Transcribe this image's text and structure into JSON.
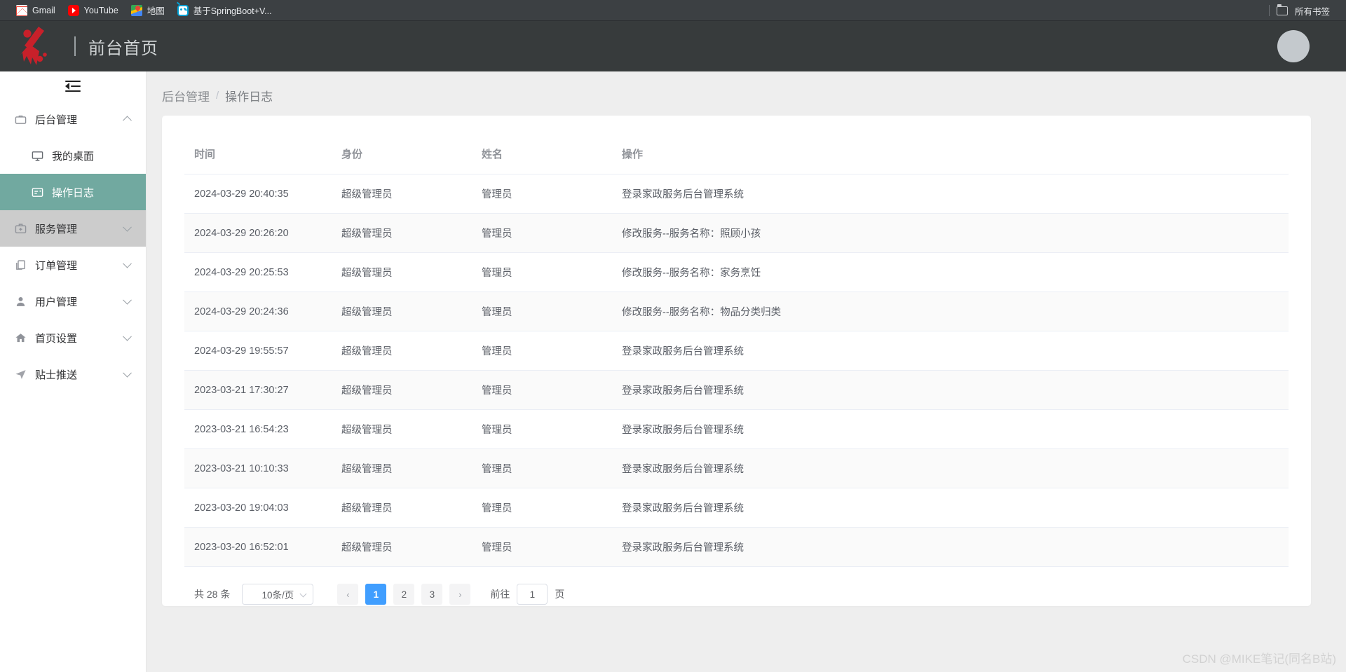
{
  "browser": {
    "bookmarks": [
      {
        "label": "Gmail",
        "icon": "gmail-icon"
      },
      {
        "label": "YouTube",
        "icon": "youtube-icon"
      },
      {
        "label": "地图",
        "icon": "maps-icon"
      },
      {
        "label": "基于SpringBoot+V...",
        "icon": "bilibili-icon"
      }
    ],
    "all_bookmarks_label": "所有书签",
    "all_bookmarks_icon": "folder-icon"
  },
  "header": {
    "logo_icon": "broom-logo-icon",
    "title": "前台首页",
    "avatar_icon": "user-avatar"
  },
  "sidebar": {
    "collapse_icon": "menu-fold-icon",
    "items": [
      {
        "label": "后台管理",
        "icon": "briefcase-icon",
        "expanded": true,
        "state": "normal",
        "children": [
          {
            "label": "我的桌面",
            "icon": "monitor-icon",
            "active": false
          },
          {
            "label": "操作日志",
            "icon": "log-message-icon",
            "active": true
          }
        ]
      },
      {
        "label": "服务管理",
        "icon": "first-aid-kit-icon",
        "expanded": false,
        "state": "hovered",
        "children": []
      },
      {
        "label": "订单管理",
        "icon": "documents-copy-icon",
        "expanded": false,
        "state": "normal",
        "children": []
      },
      {
        "label": "用户管理",
        "icon": "user-solid-icon",
        "expanded": false,
        "state": "normal",
        "children": []
      },
      {
        "label": "首页设置",
        "icon": "house-icon",
        "expanded": false,
        "state": "normal",
        "children": []
      },
      {
        "label": "贴士推送",
        "icon": "paper-plane-icon",
        "expanded": false,
        "state": "normal",
        "children": []
      }
    ]
  },
  "breadcrumb": {
    "root": "后台管理",
    "separator": "/",
    "current": "操作日志"
  },
  "table": {
    "columns": [
      "时间",
      "身份",
      "姓名",
      "操作"
    ],
    "rows": [
      [
        "2024-03-29 20:40:35",
        "超级管理员",
        "管理员",
        "登录家政服务后台管理系统"
      ],
      [
        "2024-03-29 20:26:20",
        "超级管理员",
        "管理员",
        "修改服务--服务名称：照顾小孩"
      ],
      [
        "2024-03-29 20:25:53",
        "超级管理员",
        "管理员",
        "修改服务--服务名称：家务烹饪"
      ],
      [
        "2024-03-29 20:24:36",
        "超级管理员",
        "管理员",
        "修改服务--服务名称：物品分类归类"
      ],
      [
        "2024-03-29 19:55:57",
        "超级管理员",
        "管理员",
        "登录家政服务后台管理系统"
      ],
      [
        "2023-03-21 17:30:27",
        "超级管理员",
        "管理员",
        "登录家政服务后台管理系统"
      ],
      [
        "2023-03-21 16:54:23",
        "超级管理员",
        "管理员",
        "登录家政服务后台管理系统"
      ],
      [
        "2023-03-21 10:10:33",
        "超级管理员",
        "管理员",
        "登录家政服务后台管理系统"
      ],
      [
        "2023-03-20 19:04:03",
        "超级管理员",
        "管理员",
        "登录家政服务后台管理系统"
      ],
      [
        "2023-03-20 16:52:01",
        "超级管理员",
        "管理员",
        "登录家政服务后台管理系统"
      ]
    ]
  },
  "pagination": {
    "total_text": "共 28 条",
    "page_size_label": "10条/页",
    "prev_label": "‹",
    "next_label": "›",
    "pages": [
      "1",
      "2",
      "3"
    ],
    "current_page": "1",
    "jump_label": "前往",
    "jump_value": "1",
    "jump_suffix": "页"
  },
  "watermark": "CSDN @MIKE笔记(同名B站)",
  "colors": {
    "header_bg": "#373b3c",
    "active_menu": "#71a9a0",
    "hover_menu": "#cccccc",
    "page_bg": "#eeeeee",
    "pagination_active": "#409eff",
    "logo_red": "#c8202a"
  }
}
